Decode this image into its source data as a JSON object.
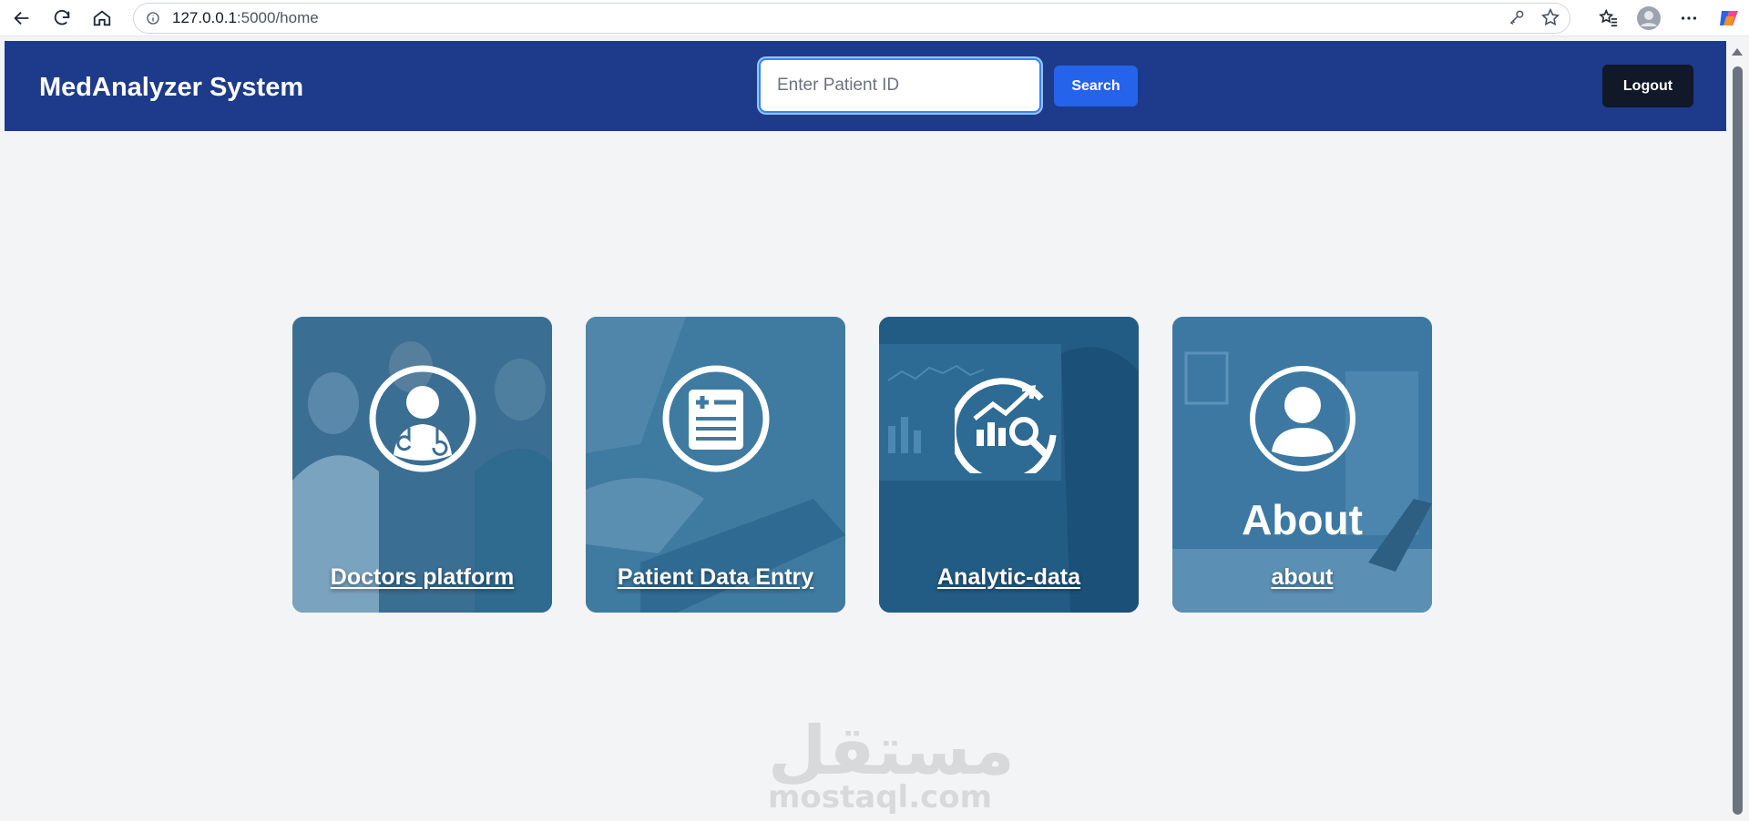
{
  "browser": {
    "url_host": "127.0.0.1",
    "url_path": ":5000/home"
  },
  "header": {
    "brand": "MedAnalyzer System",
    "search_placeholder": "Enter Patient ID",
    "search_label": "Search",
    "logout_label": "Logout"
  },
  "cards": [
    {
      "label": "Doctors platform",
      "icon": "doctor-icon"
    },
    {
      "label": "Patient Data Entry",
      "icon": "medical-report-icon"
    },
    {
      "label": "Analytic-data",
      "icon": "analytics-icon"
    },
    {
      "label": "about",
      "icon": "user-icon",
      "big_word": "About"
    }
  ],
  "watermark": {
    "arabic": "مستقل",
    "latin": "mostaql.com"
  },
  "colors": {
    "header": "#1e3a8a",
    "search_button": "#2563eb",
    "logout_button": "#111827",
    "page_background": "#f3f4f6"
  }
}
